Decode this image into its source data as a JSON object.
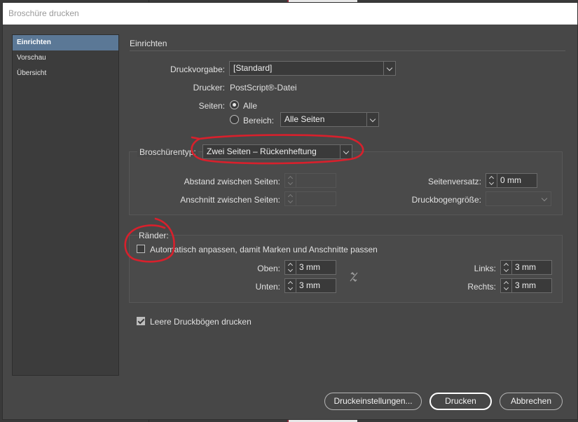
{
  "window": {
    "title": "Broschüre drucken"
  },
  "sidebar": {
    "items": [
      {
        "label": "Einrichten",
        "active": true
      },
      {
        "label": "Vorschau",
        "active": false
      },
      {
        "label": "Übersicht",
        "active": false
      }
    ]
  },
  "setup": {
    "section_title": "Einrichten",
    "preset_label": "Druckvorgabe:",
    "preset_value": "[Standard]",
    "printer_label": "Drucker:",
    "printer_value": "PostScript®-Datei",
    "pages_label": "Seiten:",
    "pages_all": "Alle",
    "pages_range": "Bereich:",
    "range_value": "Alle Seiten",
    "pages_selected": "all"
  },
  "booklet": {
    "type_label": "Broschürentyp:",
    "type_value": "Zwei Seiten – Rückenheftung",
    "spacing_label": "Abstand zwischen Seiten:",
    "spacing_value": "",
    "bleed_label": "Anschnitt zwischen Seiten:",
    "bleed_value": "",
    "creep_label": "Seitenversatz:",
    "creep_value": "0 mm",
    "sheet_label": "Druckbogengröße:",
    "sheet_value": ""
  },
  "margins": {
    "legend": "Ränder:",
    "auto_fit_label": "Automatisch anpassen, damit Marken und Anschnitte passen",
    "auto_fit_checked": false,
    "top_label": "Oben:",
    "top_value": "3 mm",
    "bottom_label": "Unten:",
    "bottom_value": "3 mm",
    "left_label": "Links:",
    "left_value": "3 mm",
    "right_label": "Rechts:",
    "right_value": "3 mm"
  },
  "print_blank": {
    "label": "Leere Druckbögen drucken",
    "checked": true
  },
  "buttons": {
    "print_settings": "Druckeinstellungen...",
    "print": "Drucken",
    "cancel": "Abbrechen"
  },
  "colors": {
    "dialog_bg": "#474747",
    "sidebar_active": "#5b7896",
    "annotation": "#d8202c"
  }
}
